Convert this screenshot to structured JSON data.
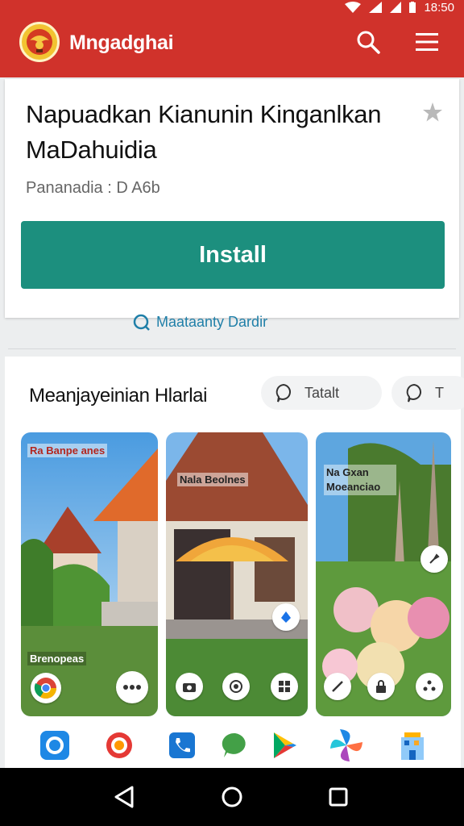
{
  "status_bar": {
    "time": "18:50"
  },
  "app_bar": {
    "title": "Mngadghai"
  },
  "app": {
    "name": "Napuadkan Kianunin Kinganlkan MaDahuidia",
    "meta": "Pananadia : D A6b",
    "install_label": "Install",
    "secondary_link": "Maataanty Dardir"
  },
  "screenshots_section": {
    "title": "Meanjayeinian Hlarlai",
    "chips": [
      {
        "label": "Tatalt"
      },
      {
        "label": "T"
      }
    ],
    "screenshots": [
      {
        "top_label": "Ra Banpe anes",
        "bottom_label": "Brenopeas"
      },
      {
        "top_label": "Nala Beolnes"
      },
      {
        "top_label": "Na Gxan Moeanciao"
      }
    ]
  },
  "colors": {
    "primary_red": "#d0322b",
    "install_green": "#1c8f7e",
    "link_blue": "#1f7fa8"
  }
}
